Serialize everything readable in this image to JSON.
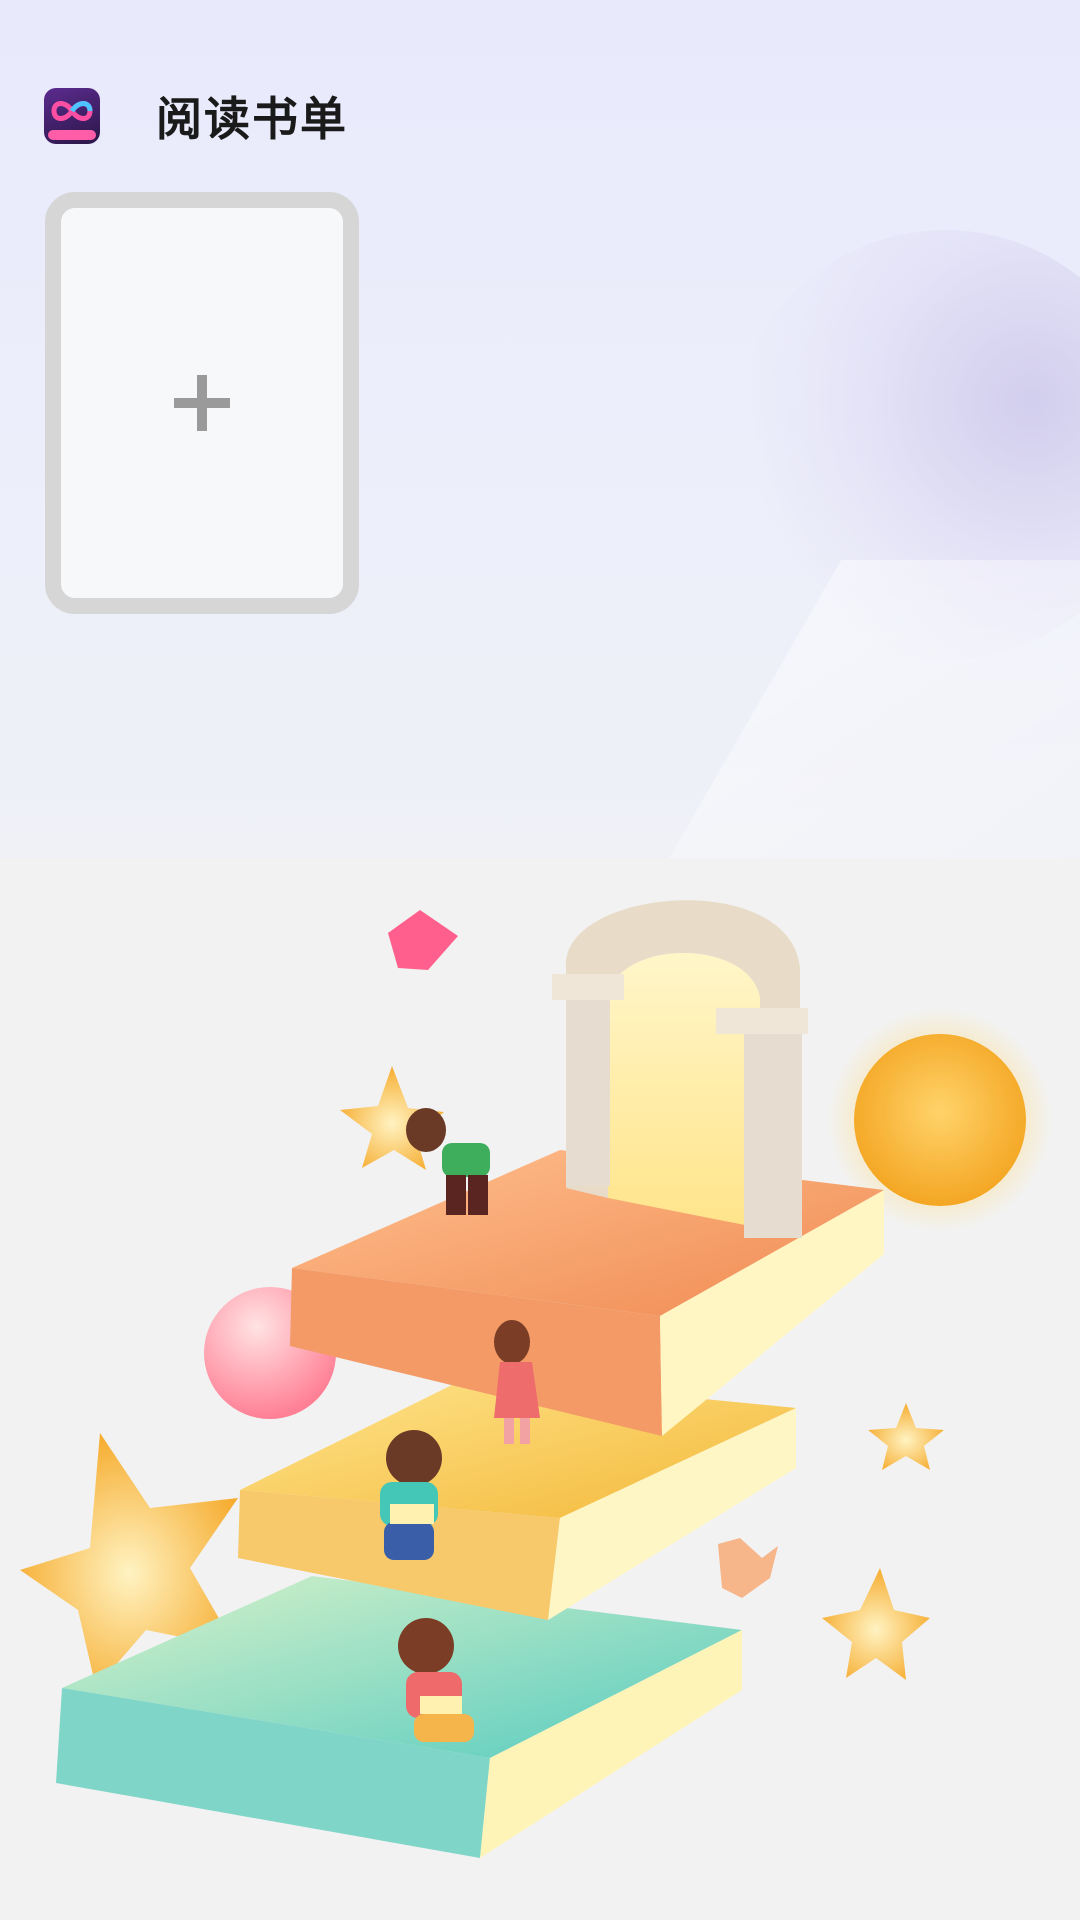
{
  "header": {
    "app_icon": "app-logo-icon",
    "title": "阅读书单"
  },
  "booklist": {
    "add_icon": "plus-icon"
  },
  "colors": {
    "top_background": "#e9eafb",
    "card_border": "#d6d6d6",
    "card_fill": "#f7f8fa",
    "plus": "#9a9a9a",
    "bottom_background": "#f2f2f2",
    "book_orange": "#f08a52",
    "book_yellow": "#f3b838",
    "book_teal": "#5ecfc0",
    "moon": "#f7b93a"
  }
}
